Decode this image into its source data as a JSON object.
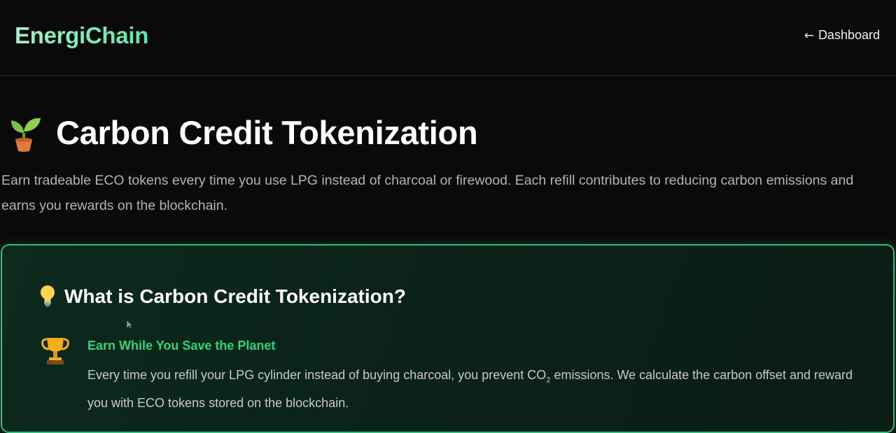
{
  "header": {
    "logo": "EnergiChain",
    "dashboard_link": "Dashboard",
    "dashboard_arrow": "←"
  },
  "page": {
    "title_icon": "sprout-icon",
    "title": "Carbon Credit Tokenization",
    "intro": "Earn tradeable ECO tokens every time you use LPG instead of charcoal or firewood. Each refill contributes to reducing carbon emissions and earns you rewards on the blockchain."
  },
  "info_card": {
    "icon": "lightbulb-icon",
    "title": "What is Carbon Credit Tokenization?",
    "features": [
      {
        "icon": "trophy-icon",
        "title": "Earn While You Save the Planet",
        "desc_before": "Every time you refill your LPG cylinder instead of buying charcoal, you prevent CO",
        "desc_sub": "2",
        "desc_after": " emissions. We calculate the carbon offset and reward you with ECO tokens stored on the blockchain."
      }
    ]
  },
  "colors": {
    "background": "#0a0a0a",
    "accent_green": "#33d17a",
    "card_border": "#2fbf78",
    "logo_gradient_start": "#a6f0c8",
    "logo_gradient_end": "#5fe3a8"
  }
}
